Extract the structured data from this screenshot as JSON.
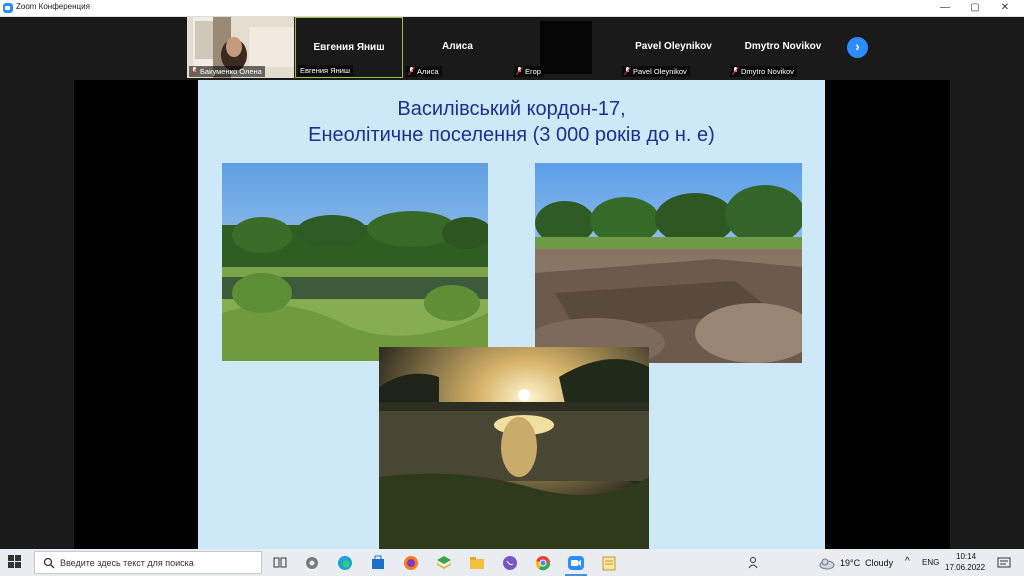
{
  "window": {
    "title": "Zoom Конференция",
    "controls": {
      "minimize": "—",
      "maximize": "▢",
      "close": "✕"
    }
  },
  "gallery": {
    "participants": [
      {
        "name": "",
        "caption": "Бакуменко Олена",
        "muted": true,
        "video": true
      },
      {
        "name": "Евгения Яниш",
        "caption": "Евгения Яниш",
        "muted": false,
        "active": true
      },
      {
        "name": "Алиса",
        "caption": "Алиса",
        "muted": true
      },
      {
        "name": "",
        "caption": "Егор",
        "muted": true,
        "video": true
      },
      {
        "name": "Pavel Oleynikov",
        "caption": "Pavel Oleynikov",
        "muted": true
      },
      {
        "name": "Dmytro Novikov",
        "caption": "Dmytro Novikov",
        "muted": true
      }
    ],
    "next_icon": "chevron-right-icon"
  },
  "slide": {
    "title_line1": "Василівський кордон-17,",
    "title_line2": "Енеолітичне поселення (3 000 років до н. е)",
    "photos": [
      "lake-photo",
      "excavation-photo",
      "sunset-photo"
    ]
  },
  "taskbar": {
    "search_placeholder": "Введите здесь текст для поиска",
    "weather": "19°C  Cloudy",
    "language": "ENG",
    "time": "10:14",
    "date": "17.06.2022",
    "accent": "#4a90e2"
  }
}
